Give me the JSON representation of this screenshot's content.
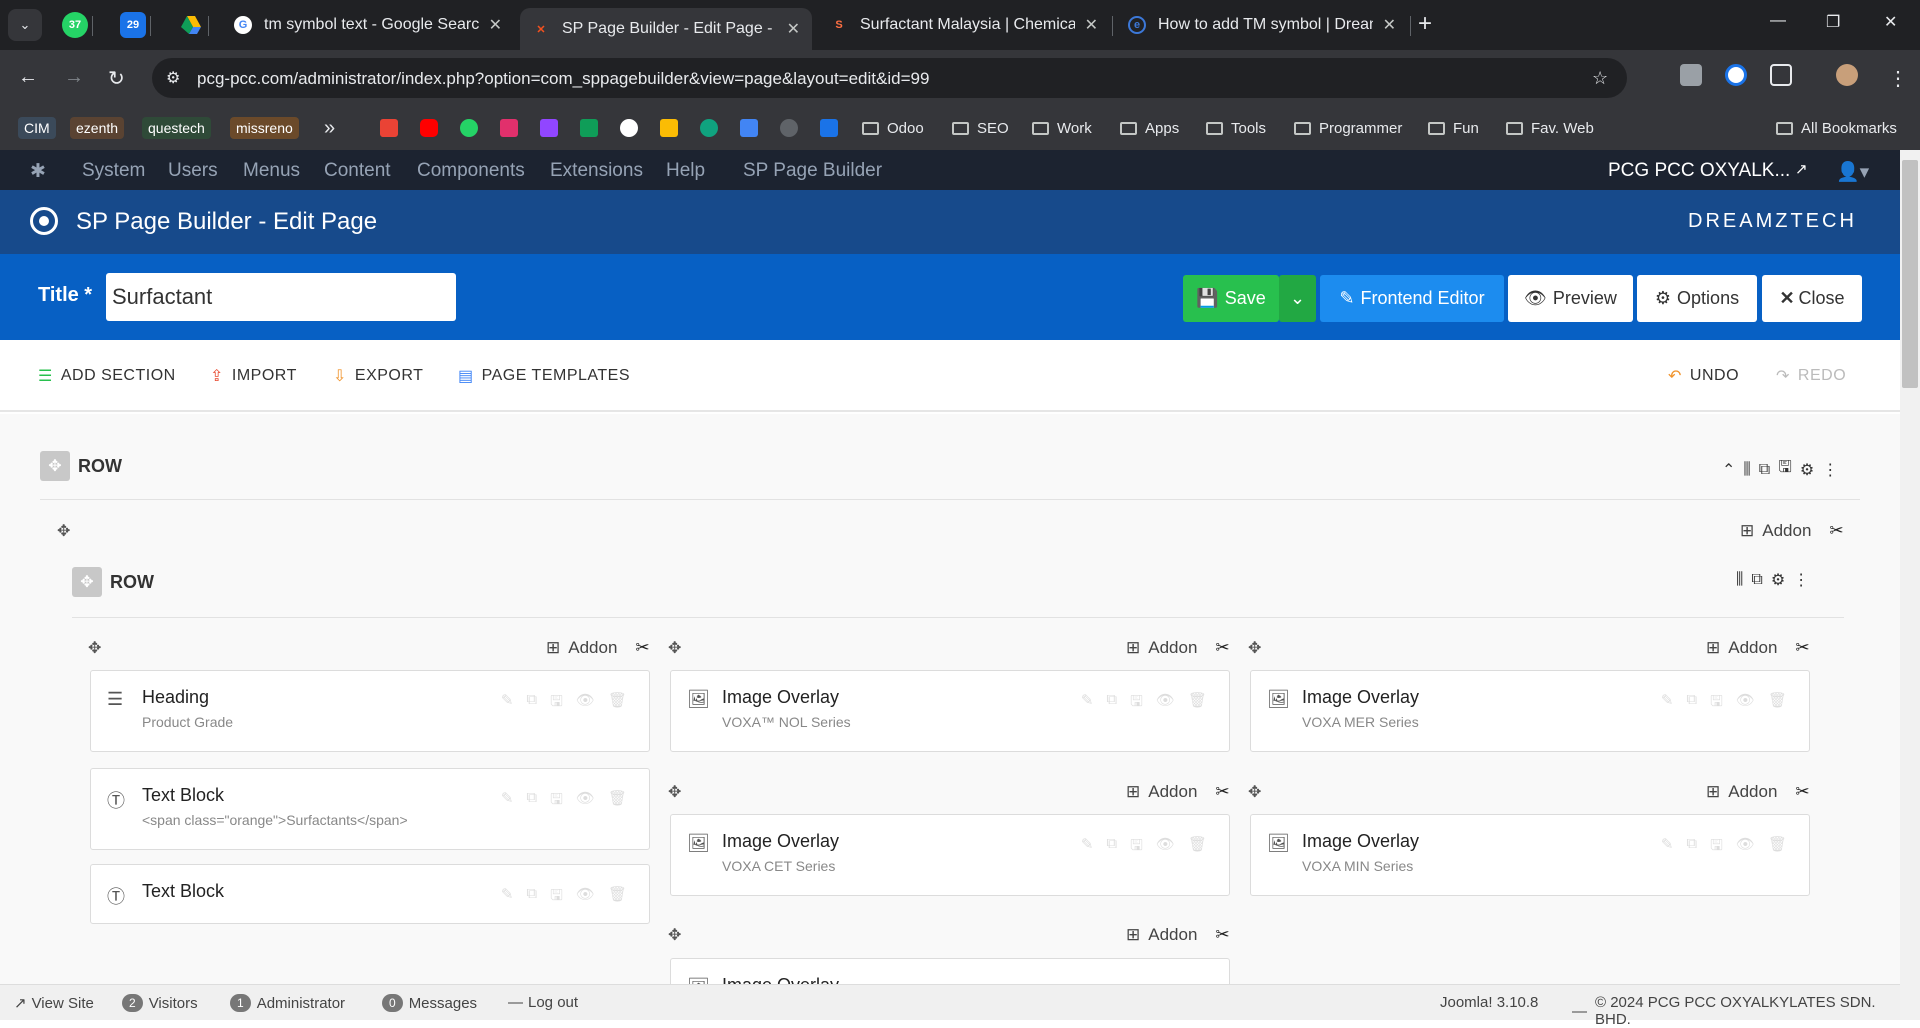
{
  "browser": {
    "pinned": [
      {
        "badge": "37",
        "color": "#25d366"
      },
      {
        "badge": "29",
        "color": "#1a73e8"
      },
      {
        "badge": "",
        "color": "#fbbc04"
      }
    ],
    "tabs": [
      {
        "label": "tm symbol text - Google Search",
        "fav": "G",
        "fav_color": "#4285f4"
      },
      {
        "label": "SP Page Builder - Edit Page - PC",
        "fav": "✕",
        "fav_color": "#f4511e"
      },
      {
        "label": "Surfactant Malaysia | Chemical I",
        "fav": "S",
        "fav_color": "#ff7043"
      },
      {
        "label": "How to add TM symbol | Dream",
        "fav": "e",
        "fav_color": "#3c78d8"
      }
    ],
    "url": "pcg-pcc.com/administrator/index.php?option=com_sppagebuilder&view=page&layout=edit&id=99",
    "bookmarks": {
      "chips": [
        {
          "label": "CIM",
          "bg": "#3b4a5a",
          "fg": "#ffffff"
        },
        {
          "label": "ezenth",
          "bg": "#5a4332",
          "fg": "#ffffff"
        },
        {
          "label": "questech",
          "bg": "#2f4a38",
          "fg": "#ffffff"
        },
        {
          "label": "missreno",
          "bg": "#6b4a2a",
          "fg": "#ffffff"
        }
      ],
      "folders": [
        "Odoo",
        "SEO",
        "Work",
        "Apps",
        "Tools",
        "Programmer",
        "Fun",
        "Fav. Web"
      ],
      "all": "All Bookmarks"
    }
  },
  "joomla": {
    "menu": [
      "System",
      "Users",
      "Menus",
      "Content",
      "Components",
      "Extensions",
      "Help",
      "SP Page Builder"
    ],
    "site_name": "PCG PCC OXYALK...",
    "page_title": "SP Page Builder - Edit Page",
    "brand": "DREAMZTECH",
    "title_label": "Title *",
    "title_value": "Surfactant",
    "buttons": {
      "save": "Save",
      "frontend": "Frontend Editor",
      "preview": "Preview",
      "options": "Options",
      "close": "Close"
    },
    "toolbar": {
      "add_section": "ADD SECTION",
      "import": "IMPORT",
      "export": "EXPORT",
      "templates": "PAGE TEMPLATES",
      "undo": "UNDO",
      "redo": "REDO"
    }
  },
  "builder": {
    "row_label": "ROW",
    "inner_row_label": "ROW",
    "addon_label": "Addon",
    "columns": [
      {
        "addons": [
          {
            "name": "Heading",
            "sub": "Product Grade",
            "icon": "heading-icon"
          },
          {
            "name": "Text Block",
            "sub": "<span class=\"orange\">Surfactants</span>",
            "icon": "text-icon"
          },
          {
            "name": "Text Block",
            "sub": "",
            "icon": "text-icon"
          }
        ]
      },
      {
        "addons": [
          {
            "name": "Image Overlay",
            "sub": "VOXA™ NOL Series",
            "icon": "image-icon"
          },
          {
            "name": "Image Overlay",
            "sub": "VOXA CET Series",
            "icon": "image-icon"
          },
          {
            "name": "Image Overlay",
            "sub": "",
            "icon": "image-icon"
          }
        ]
      },
      {
        "addons": [
          {
            "name": "Image Overlay",
            "sub": "VOXA MER Series",
            "icon": "image-icon"
          },
          {
            "name": "Image Overlay",
            "sub": "VOXA MIN Series",
            "icon": "image-icon"
          }
        ]
      }
    ]
  },
  "status": {
    "view_site": "View Site",
    "visitors_count": "2",
    "visitors": "Visitors",
    "admin_count": "1",
    "admin": "Administrator",
    "messages_count": "0",
    "messages": "Messages",
    "logout": "Log out",
    "version": "Joomla! 3.10.8",
    "copyright": "© 2024 PCG PCC OXYALKYLATES SDN. BHD."
  },
  "colors": {
    "save_green": "#28c04e",
    "primary_blue": "#0760c4",
    "header_blue": "#174a8b",
    "admin_dark": "#1c2330"
  }
}
